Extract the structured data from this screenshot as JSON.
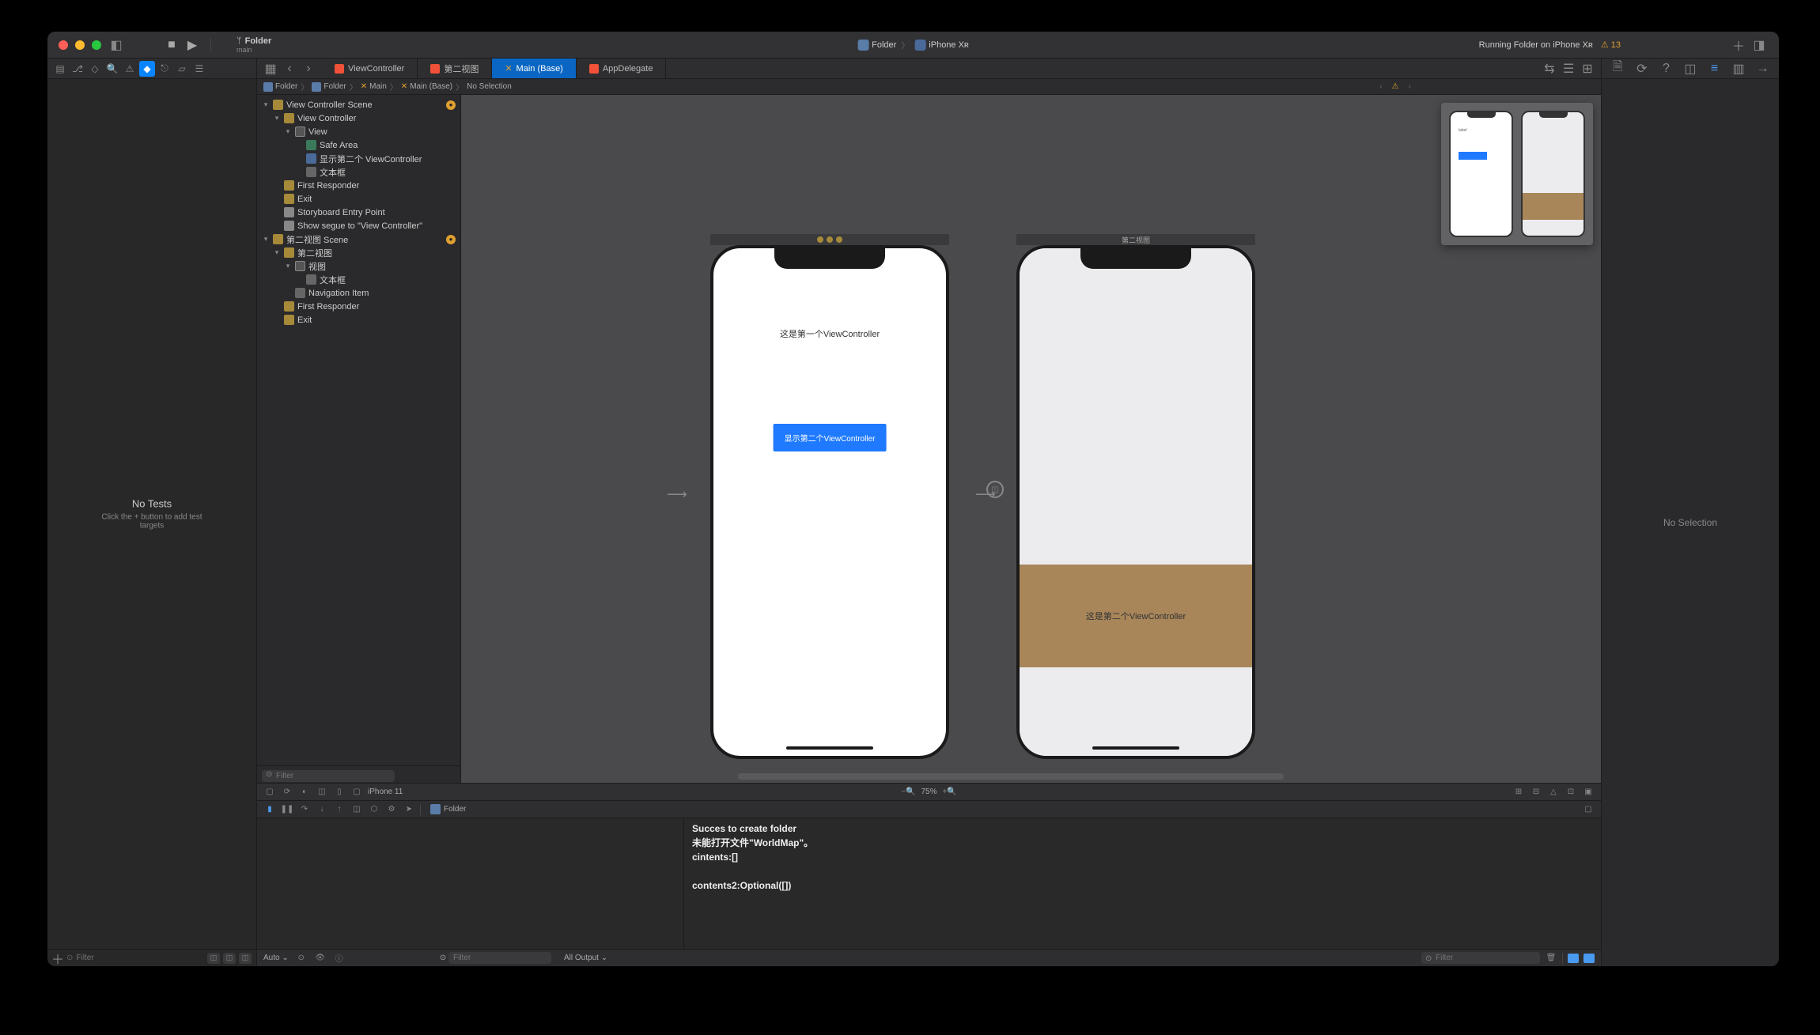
{
  "titlebar": {
    "project": "Folder",
    "branch": "main",
    "scheme": "Folder",
    "device": "iPhone Xʀ",
    "status": "Running Folder on iPhone Xʀ",
    "warnings": "13"
  },
  "file_tabs": [
    {
      "label": "ViewController",
      "type": "swift",
      "active": false
    },
    {
      "label": "第二视图",
      "type": "swift",
      "active": false
    },
    {
      "label": "Main (Base)",
      "type": "storyboard",
      "active": true
    },
    {
      "label": "AppDelegate",
      "type": "swift",
      "active": false
    }
  ],
  "breadcrumb": [
    "Folder",
    "Folder",
    "Main",
    "Main (Base)",
    "No Selection"
  ],
  "navigator": {
    "empty_title": "No Tests",
    "empty_subtitle": "Click the + button to add test targets",
    "filter_placeholder": "Filter"
  },
  "outline": {
    "filter_placeholder": "Filter",
    "scenes": [
      {
        "name": "View Controller Scene",
        "warn": true,
        "children": [
          {
            "name": "View Controller",
            "icon": "vc",
            "indent": 1,
            "arrow": true,
            "children": [
              {
                "name": "View",
                "icon": "view",
                "indent": 2,
                "arrow": true,
                "children": [
                  {
                    "name": "Safe Area",
                    "icon": "safe",
                    "indent": 3
                  },
                  {
                    "name": "显示第二个 ViewController",
                    "icon": "button",
                    "indent": 3
                  },
                  {
                    "name": "文本框",
                    "icon": "label",
                    "indent": 3
                  }
                ]
              },
              {
                "name": "First Responder",
                "icon": "resp",
                "indent": 1
              },
              {
                "name": "Exit",
                "icon": "exit",
                "indent": 1
              },
              {
                "name": "Storyboard Entry Point",
                "icon": "entry",
                "indent": 1
              },
              {
                "name": "Show segue to \"View Controller\"",
                "icon": "segue",
                "indent": 1
              }
            ]
          }
        ]
      },
      {
        "name": "第二视图 Scene",
        "warn": true,
        "children": [
          {
            "name": "第二视图",
            "icon": "vc",
            "indent": 1,
            "arrow": true,
            "children": [
              {
                "name": "视图",
                "icon": "view",
                "indent": 2,
                "arrow": true,
                "children": [
                  {
                    "name": "文本框",
                    "icon": "label",
                    "indent": 3
                  }
                ]
              },
              {
                "name": "Navigation Item",
                "icon": "nav",
                "indent": 2
              }
            ]
          },
          {
            "name": "First Responder",
            "icon": "resp",
            "indent": 1
          },
          {
            "name": "Exit",
            "icon": "exit",
            "indent": 1
          }
        ]
      }
    ]
  },
  "canvas": {
    "zoom": "75%",
    "device_label": "iPhone 11",
    "scene1": {
      "title_dots": true,
      "label": "这是第一个ViewController",
      "button": "显示第二个ViewController"
    },
    "scene2": {
      "title": "第二视图",
      "label": "这是第二个ViewController"
    }
  },
  "debug": {
    "target": "Folder",
    "auto_label": "Auto",
    "all_output": "All Output",
    "filter_placeholder": "Filter",
    "console_lines": [
      {
        "bold": true,
        "text": "Succes to create folder"
      },
      {
        "bold": true,
        "text": "未能打开文件\"WorldMap\"。"
      },
      {
        "bold": true,
        "text": "cintents:[]"
      },
      {
        "bold": false,
        "text": ""
      },
      {
        "bold": true,
        "text": "contents2:Optional([])"
      }
    ]
  },
  "inspector": {
    "empty": "No Selection"
  }
}
